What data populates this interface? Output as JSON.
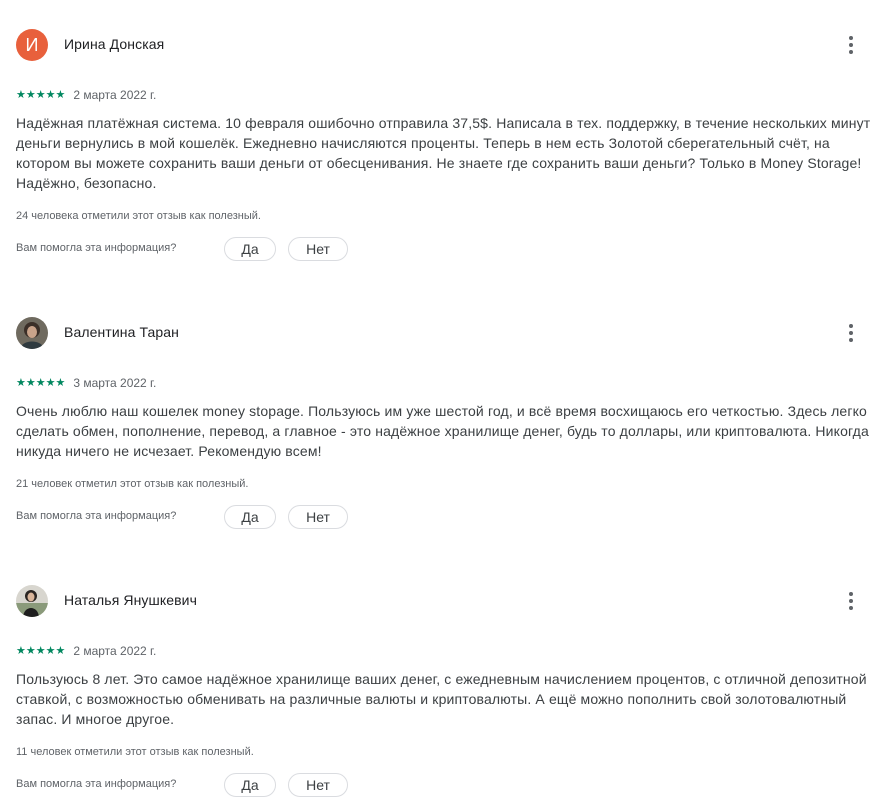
{
  "reviews": [
    {
      "author": "Ирина Донская",
      "avatar_letter": "И",
      "stars": "★★★★★",
      "date": "2 марта 2022 г.",
      "text": "Надёжная платёжная система. 10 февраля ошибочно отправила 37,5$. Написала в тех. поддержку, в течение нескольких минут деньги вернулись в мой кошелёк. Ежедневно начисляются проценты. Теперь в нем есть Золотой сберегательный счёт, на котором вы можете сохранить ваши деньги от обесценивания. Не знаете где сохранить ваши деньги? Только в Money Storage! Надёжно, безопасно.",
      "helpful_count": "24 человека отметили этот отзыв как полезный.",
      "question": "Вам помогла эта информация?",
      "yes_label": "Да",
      "no_label": "Нет"
    },
    {
      "author": "Валентина Таран",
      "stars": "★★★★★",
      "date": "3 марта 2022 г.",
      "text": "Очень люблю наш кошелек money stopage. Пользуюсь им уже шестой год, и всё время восхищаюсь его четкостью. Здесь легко сделать обмен, пополнение, перевод, а главное - это надёжное хранилище денег, будь то доллары, или криптовалюта. Никогда никуда ничего не исчезает. Рекомендую всем!",
      "helpful_count": "21 человек отметил этот отзыв как полезный.",
      "question": "Вам помогла эта информация?",
      "yes_label": "Да",
      "no_label": "Нет"
    },
    {
      "author": "Наталья Янушкевич",
      "stars": "★★★★★",
      "date": "2 марта 2022 г.",
      "text": "Пользуюсь 8 лет. Это самое надёжное хранилище ваших денег, с ежедневным начислением процентов, с отличной депозитной ставкой, с возможностью обменивать на различные валюты и криптовалюты. А ещё можно пополнить свой золотовалютный запас. И многое другое.",
      "helpful_count": "11 человек отметили этот отзыв как полезный.",
      "question": "Вам помогла эта информация?",
      "yes_label": "Да",
      "no_label": "Нет"
    }
  ],
  "colors": {
    "star": "#01875f",
    "avatar_letter_bg": "#e8603c"
  },
  "icons": {
    "menu": "more-vert-icon",
    "star": "star-icon"
  }
}
